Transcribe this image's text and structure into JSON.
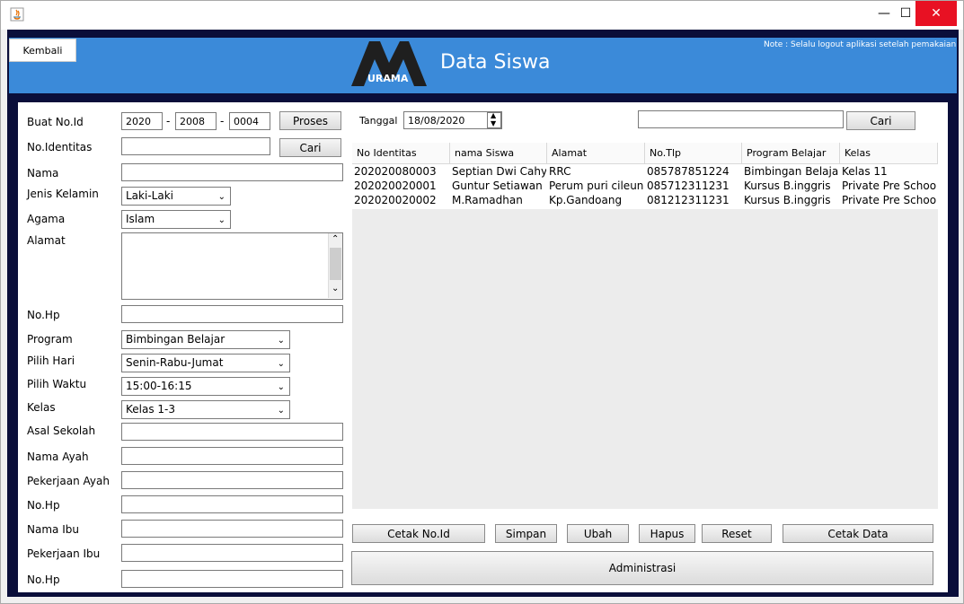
{
  "header": {
    "back_label": "Kembali",
    "title": "Data Siswa",
    "note": "Note : Selalu logout aplikasi setelah pemakaian",
    "logo_text": "URAMA"
  },
  "form": {
    "noid_label": "Buat No.Id",
    "noid_year": "2020",
    "noid_mid": "2008",
    "noid_seq": "0004",
    "noid_sep": "-",
    "proses_label": "Proses",
    "identitas_label": "No.Identitas",
    "identitas_value": "",
    "cari_label": "Cari",
    "nama_label": "Nama",
    "jk_label": "Jenis Kelamin",
    "jk_value": "Laki-Laki",
    "agama_label": "Agama",
    "agama_value": "Islam",
    "alamat_label": "Alamat",
    "nohp_label": "No.Hp",
    "program_label": "Program",
    "program_value": "Bimbingan Belajar",
    "hari_label": "Pilih Hari",
    "hari_value": "Senin-Rabu-Jumat",
    "waktu_label": "Pilih Waktu",
    "waktu_value": "15:00-16:15",
    "kelas_label": "Kelas",
    "kelas_value": "Kelas 1-3",
    "asal_label": "Asal Sekolah",
    "ayah_label": "Nama Ayah",
    "pek_ayah_label": "Pekerjaan Ayah",
    "nohp2_label": "No.Hp",
    "ibu_label": "Nama Ibu",
    "pek_ibu_label": "Pekerjaan Ibu",
    "nohp3_label": "No.Hp"
  },
  "search": {
    "tanggal_label": "Tanggal",
    "tanggal_value": "18/08/2020",
    "query": "",
    "cari_label": "Cari"
  },
  "table": {
    "columns": [
      "No Identitas",
      "nama Siswa",
      "Alamat",
      "No.Tlp",
      "Program Belajar",
      "Kelas"
    ],
    "rows": [
      [
        "202020080003",
        "Septian Dwi Cahyo",
        "RRC",
        "085787851224",
        "Bimbingan Belajar",
        "Kelas 11"
      ],
      [
        "202020020001",
        "Guntur Setiawan",
        "Perum puri cileun...",
        "085712311231",
        "Kursus B.inggris",
        "Private Pre School"
      ],
      [
        "202020020002",
        "M.Ramadhan",
        "Kp.Gandoang",
        "081212311231",
        "Kursus B.inggris",
        "Private Pre School"
      ]
    ]
  },
  "actions": {
    "cetak_noid": "Cetak No.Id",
    "simpan": "Simpan",
    "ubah": "Ubah",
    "hapus": "Hapus",
    "reset": "Reset",
    "cetak_data": "Cetak Data",
    "administrasi": "Administrasi"
  },
  "titlebar": {
    "minimize": "—",
    "maximize": "☐",
    "close": "✕",
    "app_icon": "java-icon"
  },
  "colors": {
    "header_blue": "#3b8ad9",
    "frame_navy": "#0a0e3a",
    "close_red": "#e81123"
  }
}
